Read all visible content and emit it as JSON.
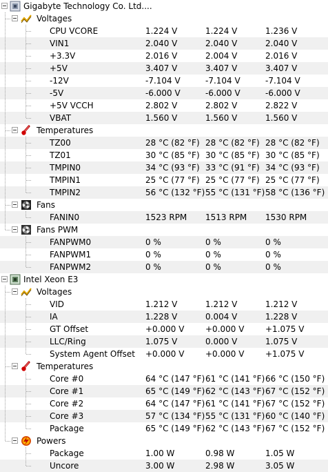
{
  "boards": [
    {
      "name": "Gigabyte Technology Co. Ltd....",
      "groups": [
        {
          "name": "Voltages",
          "icon": "voltage-icon",
          "rows": [
            {
              "label": "CPU VCORE",
              "v1": "1.224 V",
              "v2": "1.224 V",
              "v3": "1.236 V"
            },
            {
              "label": "VIN1",
              "v1": "2.040 V",
              "v2": "2.040 V",
              "v3": "2.040 V"
            },
            {
              "label": "+3.3V",
              "v1": "2.016 V",
              "v2": "2.004 V",
              "v3": "2.016 V"
            },
            {
              "label": "+5V",
              "v1": "3.407 V",
              "v2": "3.407 V",
              "v3": "3.407 V"
            },
            {
              "label": "-12V",
              "v1": "-7.104 V",
              "v2": "-7.104 V",
              "v3": "-7.104 V"
            },
            {
              "label": "-5V",
              "v1": "-6.000 V",
              "v2": "-6.000 V",
              "v3": "-6.000 V"
            },
            {
              "label": "+5V VCCH",
              "v1": "2.802 V",
              "v2": "2.802 V",
              "v3": "2.822 V"
            },
            {
              "label": "VBAT",
              "v1": "1.560 V",
              "v2": "1.560 V",
              "v3": "1.560 V"
            }
          ]
        },
        {
          "name": "Temperatures",
          "icon": "thermometer-icon",
          "rows": [
            {
              "label": "TZ00",
              "v1": "28 °C  (82 °F)",
              "v2": "28 °C  (82 °F)",
              "v3": "28 °C  (82 °F)"
            },
            {
              "label": "TZ01",
              "v1": "30 °C  (85 °F)",
              "v2": "30 °C  (85 °F)",
              "v3": "30 °C  (85 °F)"
            },
            {
              "label": "TMPIN0",
              "v1": "34 °C  (93 °F)",
              "v2": "33 °C  (91 °F)",
              "v3": "34 °C  (93 °F)"
            },
            {
              "label": "TMPIN1",
              "v1": "25 °C  (77 °F)",
              "v2": "25 °C  (77 °F)",
              "v3": "25 °C  (77 °F)"
            },
            {
              "label": "TMPIN2",
              "v1": "56 °C  (132 °F)",
              "v2": "55 °C  (131 °F)",
              "v3": "58 °C  (136 °F)"
            }
          ]
        },
        {
          "name": "Fans",
          "icon": "fan-icon",
          "rows": [
            {
              "label": "FANIN0",
              "v1": "1523 RPM",
              "v2": "1513 RPM",
              "v3": "1530 RPM"
            }
          ]
        },
        {
          "name": "Fans PWM",
          "icon": "fan-pwm-icon",
          "rows": [
            {
              "label": "FANPWM0",
              "v1": "0 %",
              "v2": "0 %",
              "v3": "0 %"
            },
            {
              "label": "FANPWM1",
              "v1": "0 %",
              "v2": "0 %",
              "v3": "0 %"
            },
            {
              "label": "FANPWM2",
              "v1": "0 %",
              "v2": "0 %",
              "v3": "0 %"
            }
          ]
        }
      ]
    },
    {
      "name": "Intel Xeon E3",
      "groups": [
        {
          "name": "Voltages",
          "icon": "voltage-icon",
          "rows": [
            {
              "label": "VID",
              "v1": "1.212 V",
              "v2": "1.212 V",
              "v3": "1.212 V"
            },
            {
              "label": "IA",
              "v1": "1.228 V",
              "v2": "0.004 V",
              "v3": "1.228 V"
            },
            {
              "label": "GT Offset",
              "v1": "+0.000 V",
              "v2": "+0.000 V",
              "v3": "+1.075 V"
            },
            {
              "label": "LLC/Ring",
              "v1": "1.075 V",
              "v2": "0.000 V",
              "v3": "1.075 V"
            },
            {
              "label": "System Agent Offset",
              "v1": "+0.000 V",
              "v2": "+0.000 V",
              "v3": "+1.075 V"
            }
          ]
        },
        {
          "name": "Temperatures",
          "icon": "thermometer-icon",
          "rows": [
            {
              "label": "Core #0",
              "v1": "64 °C  (147 °F)",
              "v2": "61 °C  (141 °F)",
              "v3": "66 °C  (150 °F)"
            },
            {
              "label": "Core #1",
              "v1": "65 °C  (149 °F)",
              "v2": "62 °C  (143 °F)",
              "v3": "67 °C  (152 °F)"
            },
            {
              "label": "Core #2",
              "v1": "64 °C  (147 °F)",
              "v2": "61 °C  (141 °F)",
              "v3": "67 °C  (152 °F)"
            },
            {
              "label": "Core #3",
              "v1": "57 °C  (134 °F)",
              "v2": "55 °C  (131 °F)",
              "v3": "60 °C  (140 °F)"
            },
            {
              "label": "Package",
              "v1": "65 °C  (149 °F)",
              "v2": "62 °C  (143 °F)",
              "v3": "67 °C  (152 °F)"
            }
          ]
        },
        {
          "name": "Powers",
          "icon": "power-icon",
          "rows": [
            {
              "label": "Package",
              "v1": "1.00 W",
              "v2": "0.98 W",
              "v3": "1.05 W"
            },
            {
              "label": "Uncore",
              "v1": "3.00 W",
              "v2": "2.98 W",
              "v3": "3.05 W"
            }
          ]
        }
      ]
    }
  ]
}
